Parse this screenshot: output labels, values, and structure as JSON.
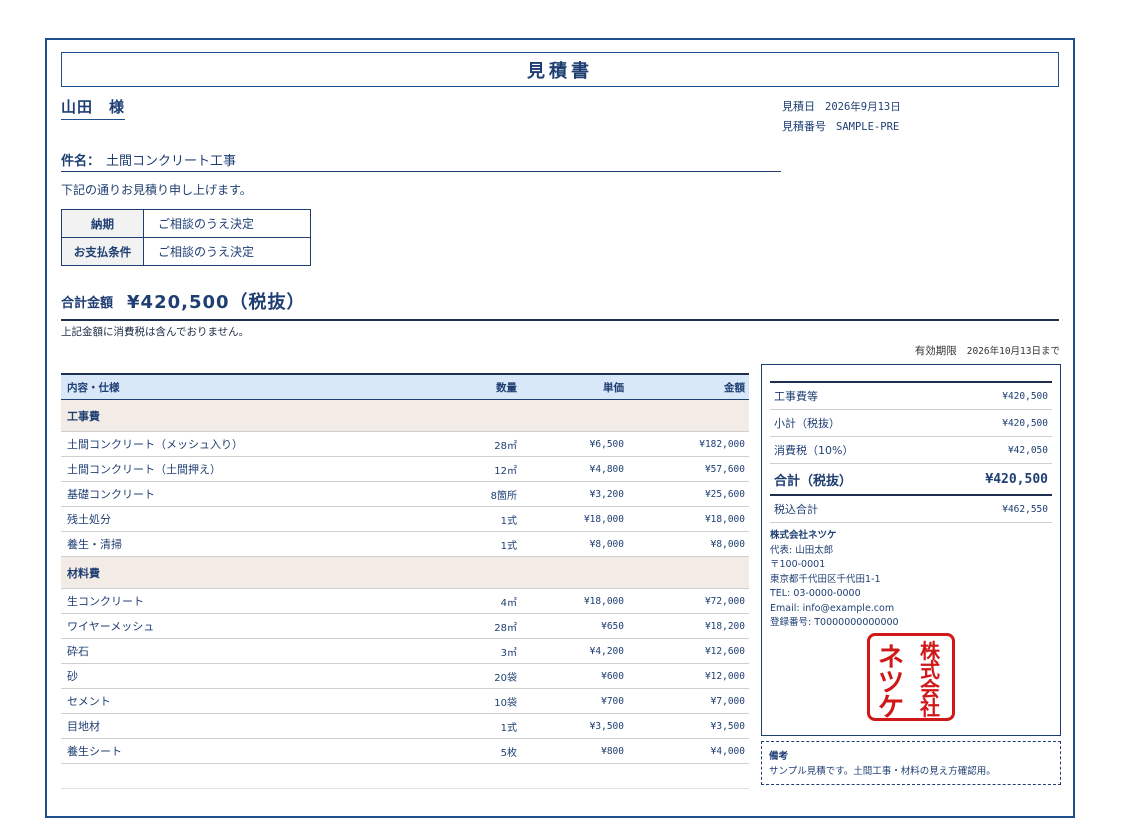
{
  "doc": {
    "title": "見積書",
    "recipient": "山田　様",
    "estimate_date_label": "見積日",
    "estimate_date": "2026年9月13日",
    "estimate_no_label": "見積番号",
    "estimate_no": "SAMPLE-PRE",
    "subject_label": "件名：",
    "subject": "土間コンクリート工事",
    "intro": "下記の通りお見積り申し上げます。",
    "terms": [
      {
        "key": "納期",
        "value": "ご相談のうえ決定"
      },
      {
        "key": "お支払条件",
        "value": "ご相談のうえ決定"
      }
    ],
    "total_label": "合計金額",
    "total_amount": "¥420,500（税抜）",
    "tax_note": "上記金額に消費税は含んでおりません。",
    "validity_label": "有効期限",
    "validity_date": "2026年10月13日まで"
  },
  "items": {
    "headers": {
      "name": "内容・仕様",
      "qty": "数量",
      "unit": "単価",
      "amount": "金額"
    },
    "groups": [
      {
        "category": "工事費",
        "rows": [
          {
            "name": "土間コンクリート（メッシュ入り）",
            "qty": "28㎡",
            "unit": "¥6,500",
            "amount": "¥182,000"
          },
          {
            "name": "土間コンクリート（土間押え）",
            "qty": "12㎡",
            "unit": "¥4,800",
            "amount": "¥57,600"
          },
          {
            "name": "基礎コンクリート",
            "qty": "8箇所",
            "unit": "¥3,200",
            "amount": "¥25,600"
          },
          {
            "name": "残土処分",
            "qty": "1式",
            "unit": "¥18,000",
            "amount": "¥18,000"
          },
          {
            "name": "養生・清掃",
            "qty": "1式",
            "unit": "¥8,000",
            "amount": "¥8,000"
          }
        ]
      },
      {
        "category": "材料費",
        "rows": [
          {
            "name": "生コンクリート",
            "qty": "4㎥",
            "unit": "¥18,000",
            "amount": "¥72,000"
          },
          {
            "name": "ワイヤーメッシュ",
            "qty": "28㎡",
            "unit": "¥650",
            "amount": "¥18,200"
          },
          {
            "name": "砕石",
            "qty": "3㎥",
            "unit": "¥4,200",
            "amount": "¥12,600"
          },
          {
            "name": "砂",
            "qty": "20袋",
            "unit": "¥600",
            "amount": "¥12,000"
          },
          {
            "name": "セメント",
            "qty": "10袋",
            "unit": "¥700",
            "amount": "¥7,000"
          },
          {
            "name": "目地材",
            "qty": "1式",
            "unit": "¥3,500",
            "amount": "¥3,500"
          },
          {
            "name": "養生シート",
            "qty": "5枚",
            "unit": "¥800",
            "amount": "¥4,000"
          }
        ]
      }
    ]
  },
  "summary": {
    "rows": [
      {
        "label": "工事費等",
        "value": "¥420,500"
      },
      {
        "label": "小計（税抜）",
        "value": "¥420,500"
      },
      {
        "label": "消費税（10%）",
        "value": "¥42,050"
      }
    ],
    "grand_label": "合計（税抜）",
    "grand_value": "¥420,500",
    "incl_label": "税込合計",
    "incl_value": "¥462,550"
  },
  "company": {
    "name": "株式会社ネツケ",
    "rep": "代表: 山田太郎",
    "zip": "〒100-0001",
    "address": "東京都千代田区千代田1-1",
    "tel": "TEL: 03-0000-0000",
    "email": "Email: info@example.com",
    "reg": "登録番号: T0000000000000",
    "seal_text": "株式会社ネツケ",
    "seal_color": "#d01818"
  },
  "remarks": {
    "title": "備考",
    "text": "サンプル見積です。土間工事・材料の見え方確認用。"
  }
}
